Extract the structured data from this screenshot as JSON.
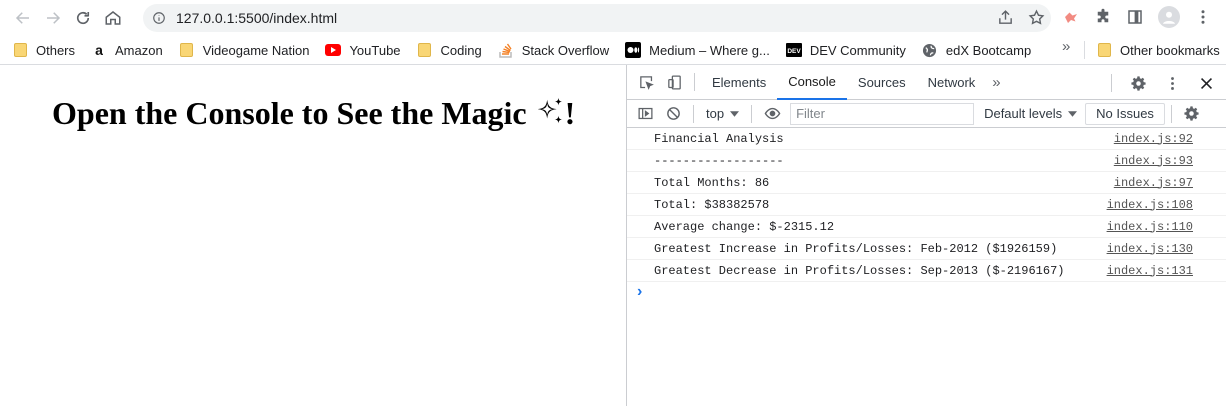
{
  "browser": {
    "url": "127.0.0.1:5500/index.html",
    "bookmarks": [
      {
        "label": "Others",
        "icon": "folder-icon"
      },
      {
        "label": "Amazon",
        "icon": "amazon-icon"
      },
      {
        "label": "Videogame Nation",
        "icon": "folder-icon"
      },
      {
        "label": "YouTube",
        "icon": "youtube-icon"
      },
      {
        "label": "Coding",
        "icon": "folder-icon"
      },
      {
        "label": "Stack Overflow",
        "icon": "stackoverflow-icon"
      },
      {
        "label": "Medium – Where g...",
        "icon": "medium-icon"
      },
      {
        "label": "DEV Community",
        "icon": "dev-icon"
      },
      {
        "label": "edX Bootcamp",
        "icon": "globe-icon"
      }
    ],
    "overflow_label": "»",
    "other_bookmarks": "Other bookmarks"
  },
  "page": {
    "heading": "Open the Console to See the Magic",
    "heading_suffix": "!"
  },
  "devtools": {
    "tabs": [
      "Elements",
      "Console",
      "Sources",
      "Network"
    ],
    "active_tab": "Console",
    "more_tabs": "»",
    "context": "top",
    "filter_placeholder": "Filter",
    "levels": "Default levels",
    "issues": "No Issues",
    "messages": [
      {
        "text": "Financial Analysis",
        "source": "index.js:92"
      },
      {
        "text": "------------------",
        "source": "index.js:93"
      },
      {
        "text": "Total Months: 86",
        "source": "index.js:97"
      },
      {
        "text": "Total: $38382578",
        "source": "index.js:108"
      },
      {
        "text": "Average change: $-2315.12",
        "source": "index.js:110"
      },
      {
        "text": "Greatest Increase in Profits/Losses: Feb-2012 ($1926159)",
        "source": "index.js:130"
      },
      {
        "text": "Greatest Decrease in Profits/Losses: Sep-2013 ($-2196167)",
        "source": "index.js:131"
      }
    ],
    "prompt_symbol": "›"
  },
  "colors": {
    "accent": "#1a73e8",
    "youtube": "#ff0000",
    "folder": "#f9d675"
  }
}
